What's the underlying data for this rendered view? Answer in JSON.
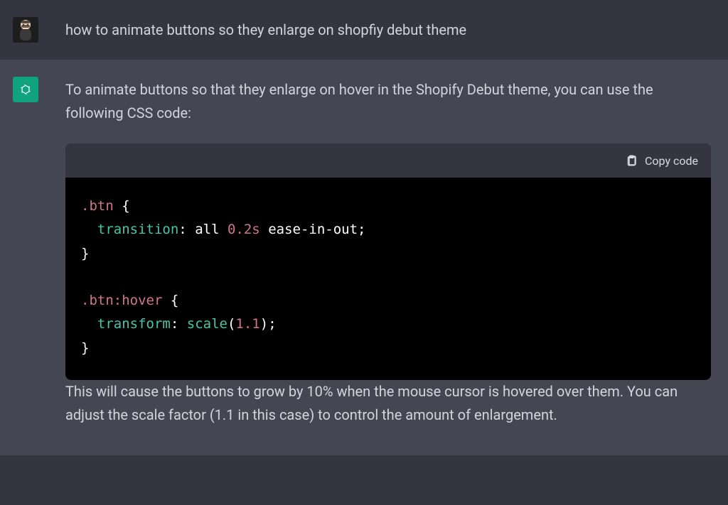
{
  "user_message": {
    "text": "how to animate buttons so they enlarge on shopfiy debut theme"
  },
  "assistant_message": {
    "intro": "To animate buttons so that they enlarge on hover in the Shopify Debut theme, you can use the following CSS code:",
    "code_header": {
      "copy_label": "Copy code"
    },
    "code_tokens": {
      "sel1": ".btn",
      "prop1": "transition",
      "val1": "all",
      "num1": "0.2s",
      "val2": "ease-in-out",
      "sel2": ".btn:hover",
      "prop2": "transform",
      "func1": "scale",
      "num2": "1.1"
    },
    "followup": "This will cause the buttons to grow by 10% when the mouse cursor is hovered over them. You can adjust the scale factor (1.1 in this case) to control the amount of enlargement."
  }
}
